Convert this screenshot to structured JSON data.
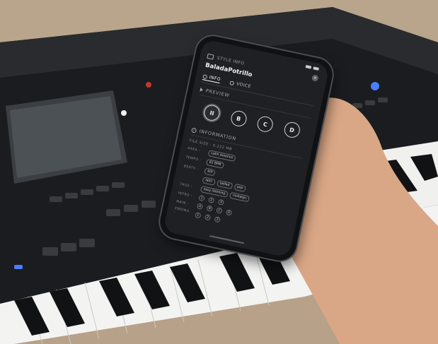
{
  "photo": {
    "alt": ""
  },
  "app": {
    "header_label": "STYLE INFO",
    "close_symbol": "×",
    "style_name": "BaladaPotrillo",
    "tabs": [
      {
        "label": "INFO",
        "active": true
      },
      {
        "label": "VOICE",
        "active": false
      }
    ]
  },
  "preview": {
    "title": "PREVIEW",
    "buttons": [
      {
        "label": "II",
        "name": "pause"
      },
      {
        "label": "B",
        "name": "b"
      },
      {
        "label": "C",
        "name": "c"
      },
      {
        "label": "D",
        "name": "d"
      }
    ]
  },
  "information": {
    "title": "INFORMATION",
    "file_meta": "FILE SIZE : 0.222 MB",
    "rows": [
      {
        "key": "AREA :",
        "chips": [
          "Latin America"
        ]
      },
      {
        "key": "TEMPO :",
        "chips": [
          "81 BPM"
        ]
      },
      {
        "key": "BEATS :",
        "chips": [
          "4/4"
        ]
      },
      {
        "key": "",
        "chips": [
          "latin",
          "ballad",
          "pop"
        ]
      },
      {
        "key": "TAGS :",
        "chips": [
          "easy listening",
          "nostalgic"
        ]
      }
    ],
    "levels": [
      {
        "key": "INTRO :",
        "values": [
          "1",
          "2",
          "3"
        ]
      },
      {
        "key": "MAIN :",
        "values": [
          "A",
          "B",
          "C",
          "D"
        ]
      },
      {
        "key": "ENDING :",
        "values": [
          "1",
          "2",
          "3"
        ]
      }
    ]
  }
}
